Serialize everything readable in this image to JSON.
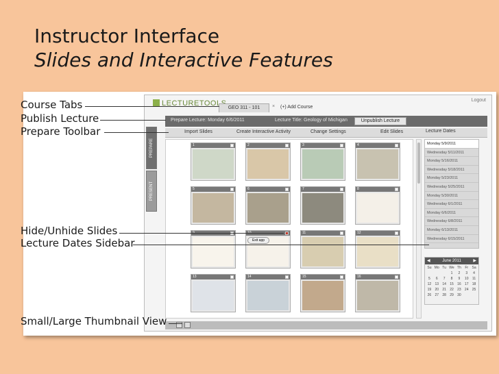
{
  "title": {
    "line1": "Instructor Interface",
    "line2": "Slides and Interactive Features"
  },
  "callouts": {
    "course_tabs": "Course Tabs",
    "publish_lecture": "Publish Lecture",
    "prepare_toolbar": "Prepare Toolbar",
    "hide_unhide": "Hide/Unhide Slides",
    "lecture_dates": "Lecture Dates Sidebar",
    "thumb_view": "Small/Large Thumbnail View"
  },
  "app": {
    "logo": "LECTURETOOLS",
    "logout": "Logout",
    "course_tab": "GEO 311 - 101",
    "tab_close": "×",
    "add_course": "(+) Add Course",
    "publish_bar": {
      "prepare_label": "Prepare Lecture: Monday 6/6/2011",
      "lecture_title": "Lecture Title: Geology of Michigan",
      "unpublish": "Unpublish Lecture"
    },
    "toolbar": {
      "import": "Import Slides",
      "create": "Create Interactive Activity",
      "settings": "Change Settings",
      "edit": "Edit Slides"
    },
    "side_tabs": {
      "prepare": "PREPARE",
      "present": "PRESENT"
    },
    "dates_header": "Lecture Dates",
    "dates": [
      "Monday 5/9/2011",
      "Wednesday 5/11/2011",
      "Monday 5/16/2011",
      "Wednesday 5/18/2011",
      "Monday 5/23/2011",
      "Wednesday 5/25/2011",
      "Monday 5/30/2011",
      "Wednesday 6/1/2011",
      "Monday 6/6/2011",
      "Wednesday 6/8/2011",
      "Monday 6/13/2011",
      "Wednesday 6/15/2011"
    ],
    "calendar": {
      "month": "June 2011",
      "weekdays": [
        "Su",
        "Mo",
        "Tu",
        "We",
        "Th",
        "Fr",
        "Sa"
      ],
      "cells": [
        "",
        "",
        "",
        "1",
        "2",
        "3",
        "4",
        "5",
        "6",
        "7",
        "8",
        "9",
        "10",
        "11",
        "12",
        "13",
        "14",
        "15",
        "16",
        "17",
        "18",
        "19",
        "20",
        "21",
        "22",
        "23",
        "24",
        "25",
        "26",
        "27",
        "28",
        "29",
        "30",
        "",
        ""
      ]
    },
    "popup": "Exit app",
    "slides": [
      {
        "num": "1",
        "tag": "PREP"
      },
      {
        "num": "2",
        "tag": "PREP"
      },
      {
        "num": "3",
        "tag": "PREP"
      },
      {
        "num": "4",
        "tag": "PREP"
      },
      {
        "num": "5",
        "tag": "PREP"
      },
      {
        "num": "6",
        "tag": "PREP"
      },
      {
        "num": "7",
        "tag": "PREP"
      },
      {
        "num": "8",
        "tag": "PREP"
      },
      {
        "num": "9",
        "tag": "PREP"
      },
      {
        "num": "10",
        "tag": "PREP"
      },
      {
        "num": "11",
        "tag": "PREP"
      },
      {
        "num": "12",
        "tag": "PREP"
      },
      {
        "num": "13",
        "tag": "PREP"
      },
      {
        "num": "14",
        "tag": "PREP"
      },
      {
        "num": "15",
        "tag": "PREP"
      },
      {
        "num": "16",
        "tag": "PREP"
      }
    ]
  },
  "colors": {
    "background": "#f8c59b",
    "toolbar_dark": "#6b6b6b",
    "logo_green": "#8cb04a"
  }
}
